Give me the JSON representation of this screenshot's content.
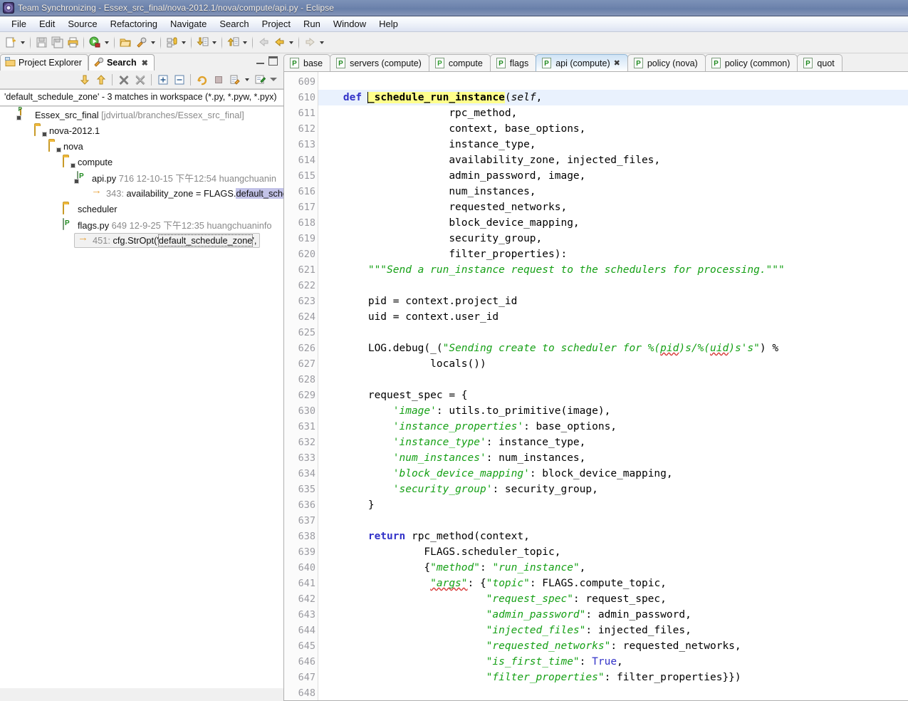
{
  "window": {
    "title": "Team Synchronizing - Essex_src_final/nova-2012.1/nova/compute/api.py - Eclipse",
    "icon": "eclipse-icon"
  },
  "menubar": {
    "items": [
      {
        "label": "File"
      },
      {
        "label": "Edit"
      },
      {
        "label": "Source"
      },
      {
        "label": "Refactoring"
      },
      {
        "label": "Navigate"
      },
      {
        "label": "Search"
      },
      {
        "label": "Project"
      },
      {
        "label": "Run"
      },
      {
        "label": "Window"
      },
      {
        "label": "Help"
      }
    ]
  },
  "toolbar": {
    "groups": [
      {
        "buttons": [
          {
            "icon": "new-file-icon"
          }
        ],
        "dropdown": true
      },
      {
        "buttons": [
          {
            "icon": "save-icon"
          },
          {
            "icon": "save-all-icon"
          },
          {
            "icon": "print-icon"
          }
        ],
        "dropdown": false
      },
      {
        "buttons": [
          {
            "icon": "debug-run-icon"
          }
        ],
        "dropdown": true
      },
      {
        "buttons": [
          {
            "icon": "open-type-icon"
          },
          {
            "icon": "search-pin-icon"
          }
        ],
        "dropdown": true
      },
      {
        "buttons": [
          {
            "icon": "toggle-breakpoint-icon"
          }
        ],
        "dropdown": true
      },
      {
        "buttons": [
          {
            "icon": "next-annotation-icon"
          }
        ],
        "dropdown": true
      },
      {
        "buttons": [
          {
            "icon": "previous-annotation-icon"
          }
        ],
        "dropdown": true
      },
      {
        "buttons": [
          {
            "icon": "back-disabled-icon"
          },
          {
            "icon": "back-icon"
          }
        ],
        "dropdown": true
      },
      {
        "buttons": [
          {
            "icon": "forward-icon"
          }
        ],
        "dropdown": true
      }
    ]
  },
  "left_view": {
    "tabs": [
      {
        "label": "Project Explorer",
        "icon": "project-explorer-icon",
        "active": false,
        "closeable": false
      },
      {
        "label": "Search",
        "icon": "search-icon",
        "active": true,
        "closeable": true,
        "close_glyph": "✖"
      }
    ],
    "window_controls": [
      {
        "name": "minimize-view-button"
      },
      {
        "name": "maximize-view-button"
      }
    ],
    "view_toolbar": [
      {
        "icon": "next-match-icon"
      },
      {
        "icon": "previous-match-icon"
      },
      {
        "separator": true
      },
      {
        "icon": "remove-selected-match-icon"
      },
      {
        "icon": "remove-all-matches-icon"
      },
      {
        "separator": true
      },
      {
        "icon": "expand-all-icon"
      },
      {
        "icon": "collapse-all-icon"
      },
      {
        "separator": true
      },
      {
        "icon": "run-current-search-icon"
      },
      {
        "icon": "cancel-search-icon"
      },
      {
        "icon": "search-history-icon"
      },
      {
        "icon": "pin-search-view-icon"
      },
      {
        "icon": "view-menu-icon"
      }
    ],
    "search_header": "'default_schedule_zone' - 3 matches in workspace (*.py, *.pyw, *.pyx)",
    "tree": [
      {
        "indent": 1,
        "icon": "project-icon",
        "name": "project-node",
        "label": "Essex_src_final",
        "suffix": " [jdvirtual/branches/Essex_src_final]",
        "suffix_muted": true
      },
      {
        "indent": 2,
        "icon": "folder-icon",
        "name": "folder-node",
        "label": "nova-2012.1"
      },
      {
        "indent": 3,
        "icon": "folder-icon",
        "name": "folder-node",
        "label": "nova"
      },
      {
        "indent": 4,
        "icon": "folder-icon",
        "name": "folder-node",
        "label": "compute"
      },
      {
        "indent": 5,
        "icon": "py-file-icon",
        "name": "file-node",
        "label": "api.py",
        "revision": "716",
        "date": "12-10-15 下午12:54",
        "author": "huangchuanin"
      },
      {
        "indent": 6,
        "icon": "match-icon",
        "name": "match-node",
        "line_no": "343:",
        "pre": " availability_zone = FLAGS.",
        "match": "default_sche",
        "post": ""
      },
      {
        "indent": 4,
        "icon": "folder-plain-icon",
        "name": "folder-node",
        "label": "scheduler"
      },
      {
        "indent": 4,
        "icon": "py-file-plain-icon",
        "name": "file-node",
        "label": "flags.py",
        "revision": "649",
        "date": "12-9-25 下午12:35",
        "author": "huangchuaninfo"
      },
      {
        "indent": 5,
        "icon": "match-icon",
        "name": "match-node",
        "selected": true,
        "line_no": "451:",
        "pre": " cfg.StrOpt('",
        "match": "default_schedule_zone",
        "post": "',"
      }
    ]
  },
  "editor": {
    "tabs": [
      {
        "label": "base",
        "icon": "py-file-icon",
        "active": false
      },
      {
        "label": "servers (compute)",
        "icon": "py-file-icon",
        "active": false
      },
      {
        "label": "compute",
        "icon": "py-init-file-icon",
        "active": false
      },
      {
        "label": "flags",
        "icon": "py-file-icon",
        "active": false
      },
      {
        "label": "api (compute)",
        "icon": "py-file-icon",
        "active": true,
        "close_glyph": "✖"
      },
      {
        "label": "policy (nova)",
        "icon": "py-file-icon",
        "active": false
      },
      {
        "label": "policy (common)",
        "icon": "py-file-icon",
        "active": false
      },
      {
        "label": "quot",
        "icon": "py-file-icon",
        "active": false
      }
    ],
    "first_line": 609,
    "current_line": 610,
    "fold_lines": [
      610
    ],
    "lines": [
      {
        "no": 609,
        "tokens": []
      },
      {
        "no": 610,
        "tokens": [
          {
            "t": "plain",
            "v": "    "
          },
          {
            "t": "kw",
            "v": "def"
          },
          {
            "t": "plain",
            "v": " "
          },
          {
            "t": "caret",
            "v": ""
          },
          {
            "t": "hl",
            "v": "_schedule_run_instance"
          },
          {
            "t": "plain",
            "v": "("
          },
          {
            "t": "ital",
            "v": "self"
          },
          {
            "t": "plain",
            "v": ","
          }
        ]
      },
      {
        "no": 611,
        "tokens": [
          {
            "t": "plain",
            "v": "                     rpc_method,"
          }
        ]
      },
      {
        "no": 612,
        "tokens": [
          {
            "t": "plain",
            "v": "                     context, base_options,"
          }
        ]
      },
      {
        "no": 613,
        "tokens": [
          {
            "t": "plain",
            "v": "                     instance_type,"
          }
        ]
      },
      {
        "no": 614,
        "tokens": [
          {
            "t": "plain",
            "v": "                     availability_zone, injected_files,"
          }
        ]
      },
      {
        "no": 615,
        "tokens": [
          {
            "t": "plain",
            "v": "                     admin_password, image,"
          }
        ]
      },
      {
        "no": 616,
        "tokens": [
          {
            "t": "plain",
            "v": "                     num_instances,"
          }
        ]
      },
      {
        "no": 617,
        "tokens": [
          {
            "t": "plain",
            "v": "                     requested_networks,"
          }
        ]
      },
      {
        "no": 618,
        "tokens": [
          {
            "t": "plain",
            "v": "                     block_device_mapping,"
          }
        ]
      },
      {
        "no": 619,
        "tokens": [
          {
            "t": "plain",
            "v": "                     security_group,"
          }
        ]
      },
      {
        "no": 620,
        "tokens": [
          {
            "t": "plain",
            "v": "                     filter_properties):"
          }
        ]
      },
      {
        "no": 621,
        "tokens": [
          {
            "t": "plain",
            "v": "        "
          },
          {
            "t": "cmt",
            "v": "\"\"\"Send a run_instance request to the schedulers for processing.\"\"\""
          }
        ]
      },
      {
        "no": 622,
        "tokens": []
      },
      {
        "no": 623,
        "tokens": [
          {
            "t": "plain",
            "v": "        pid = context.project_id"
          }
        ]
      },
      {
        "no": 624,
        "tokens": [
          {
            "t": "plain",
            "v": "        uid = context.user_id"
          }
        ]
      },
      {
        "no": 625,
        "tokens": []
      },
      {
        "no": 626,
        "tokens": [
          {
            "t": "plain",
            "v": "        LOG.debug(_("
          },
          {
            "t": "str",
            "v": "\"Sending create to scheduler for %("
          },
          {
            "t": "str-sq",
            "v": "pid"
          },
          {
            "t": "str",
            "v": ")s/%("
          },
          {
            "t": "str-sq",
            "v": "uid"
          },
          {
            "t": "str",
            "v": ")s's\""
          },
          {
            "t": "plain",
            "v": ") %"
          }
        ]
      },
      {
        "no": 627,
        "tokens": [
          {
            "t": "plain",
            "v": "                  locals())"
          }
        ]
      },
      {
        "no": 628,
        "tokens": []
      },
      {
        "no": 629,
        "tokens": [
          {
            "t": "plain",
            "v": "        request_spec = {"
          }
        ]
      },
      {
        "no": 630,
        "tokens": [
          {
            "t": "plain",
            "v": "            "
          },
          {
            "t": "str",
            "v": "'image'"
          },
          {
            "t": "plain",
            "v": ": utils.to_primitive(image),"
          }
        ]
      },
      {
        "no": 631,
        "tokens": [
          {
            "t": "plain",
            "v": "            "
          },
          {
            "t": "str",
            "v": "'instance_properties'"
          },
          {
            "t": "plain",
            "v": ": base_options,"
          }
        ]
      },
      {
        "no": 632,
        "tokens": [
          {
            "t": "plain",
            "v": "            "
          },
          {
            "t": "str",
            "v": "'instance_type'"
          },
          {
            "t": "plain",
            "v": ": instance_type,"
          }
        ]
      },
      {
        "no": 633,
        "tokens": [
          {
            "t": "plain",
            "v": "            "
          },
          {
            "t": "str",
            "v": "'num_instances'"
          },
          {
            "t": "plain",
            "v": ": num_instances,"
          }
        ]
      },
      {
        "no": 634,
        "tokens": [
          {
            "t": "plain",
            "v": "            "
          },
          {
            "t": "str",
            "v": "'block_device_mapping'"
          },
          {
            "t": "plain",
            "v": ": block_device_mapping,"
          }
        ]
      },
      {
        "no": 635,
        "tokens": [
          {
            "t": "plain",
            "v": "            "
          },
          {
            "t": "str",
            "v": "'security_group'"
          },
          {
            "t": "plain",
            "v": ": security_group,"
          }
        ]
      },
      {
        "no": 636,
        "tokens": [
          {
            "t": "plain",
            "v": "        }"
          }
        ]
      },
      {
        "no": 637,
        "tokens": []
      },
      {
        "no": 638,
        "tokens": [
          {
            "t": "plain",
            "v": "        "
          },
          {
            "t": "kw",
            "v": "return"
          },
          {
            "t": "plain",
            "v": " rpc_method(context,"
          }
        ]
      },
      {
        "no": 639,
        "tokens": [
          {
            "t": "plain",
            "v": "                 FLAGS.scheduler_topic,"
          }
        ]
      },
      {
        "no": 640,
        "tokens": [
          {
            "t": "plain",
            "v": "                 {"
          },
          {
            "t": "str",
            "v": "\"method\""
          },
          {
            "t": "plain",
            "v": ": "
          },
          {
            "t": "str",
            "v": "\"run_instance\""
          },
          {
            "t": "plain",
            "v": ","
          }
        ]
      },
      {
        "no": 641,
        "tokens": [
          {
            "t": "plain",
            "v": "                  "
          },
          {
            "t": "str-sq",
            "v": "\"args\""
          },
          {
            "t": "plain",
            "v": ": {"
          },
          {
            "t": "str",
            "v": "\"topic\""
          },
          {
            "t": "plain",
            "v": ": FLAGS.compute_topic,"
          }
        ]
      },
      {
        "no": 642,
        "tokens": [
          {
            "t": "plain",
            "v": "                           "
          },
          {
            "t": "str",
            "v": "\"request_spec\""
          },
          {
            "t": "plain",
            "v": ": request_spec,"
          }
        ]
      },
      {
        "no": 643,
        "tokens": [
          {
            "t": "plain",
            "v": "                           "
          },
          {
            "t": "str",
            "v": "\"admin_password\""
          },
          {
            "t": "plain",
            "v": ": admin_password,"
          }
        ]
      },
      {
        "no": 644,
        "tokens": [
          {
            "t": "plain",
            "v": "                           "
          },
          {
            "t": "str",
            "v": "\"injected_files\""
          },
          {
            "t": "plain",
            "v": ": injected_files,"
          }
        ]
      },
      {
        "no": 645,
        "tokens": [
          {
            "t": "plain",
            "v": "                           "
          },
          {
            "t": "str",
            "v": "\"requested_networks\""
          },
          {
            "t": "plain",
            "v": ": requested_networks,"
          }
        ]
      },
      {
        "no": 646,
        "tokens": [
          {
            "t": "plain",
            "v": "                           "
          },
          {
            "t": "str",
            "v": "\"is_first_time\""
          },
          {
            "t": "plain",
            "v": ": "
          },
          {
            "t": "kwt",
            "v": "True"
          },
          {
            "t": "plain",
            "v": ","
          }
        ]
      },
      {
        "no": 647,
        "tokens": [
          {
            "t": "plain",
            "v": "                           "
          },
          {
            "t": "str",
            "v": "\"filter_properties\""
          },
          {
            "t": "plain",
            "v": ": filter_properties}})"
          }
        ]
      },
      {
        "no": 648,
        "tokens": []
      }
    ]
  },
  "colors": {
    "keyword": "#3232c8",
    "string": "#15a015",
    "comment": "#15a015",
    "highlight": "#ffff8c",
    "current_line": "#e9f1fd",
    "match_highlight": "#c3c3e8",
    "titlebar": "#6e84ad"
  }
}
